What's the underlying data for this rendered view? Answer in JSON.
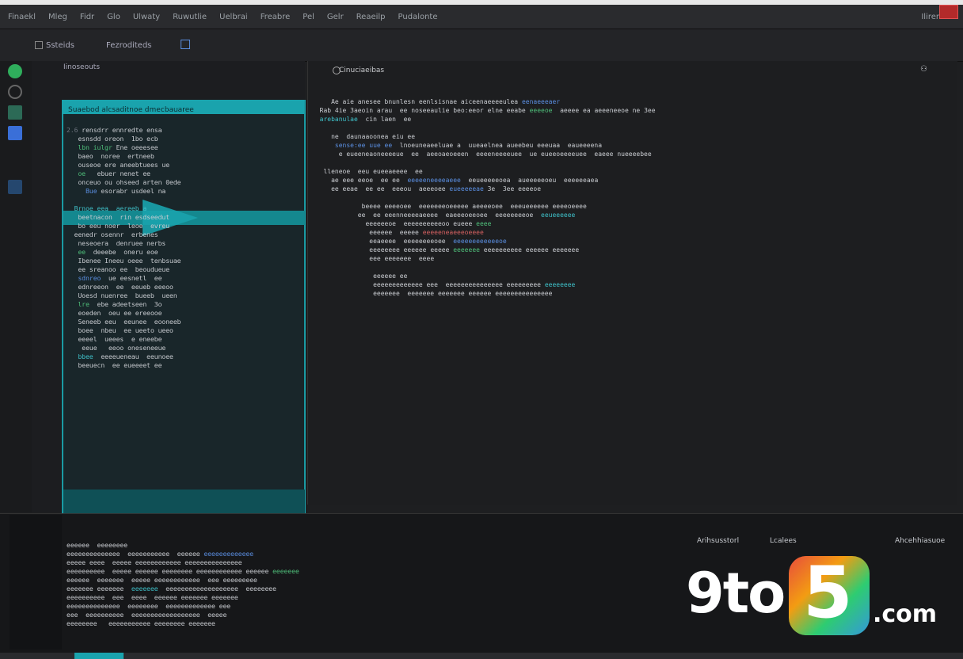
{
  "titlebar": {
    "menu": [
      "Finaekl",
      "Mleg",
      "Fidr",
      "Glo",
      "Ulwaty",
      "Ruwutlie",
      "Uelbrai",
      "Freabre",
      "Pel",
      "Gelr",
      "Reaeilp",
      "Pudalonte"
    ],
    "right_label": "Ilirer"
  },
  "toolbar": {
    "left_label": "Ssteids",
    "center_label": "Fezroditeds"
  },
  "explorer": {
    "header": "Iinoseouts",
    "teal_header": "Suaebod alcsaditnoe dmecbauaree"
  },
  "editor": {
    "tab_label": "Cinuciaeibas"
  },
  "bottom": {
    "right_labels": [
      "Arihsusstorl",
      "Lcalees",
      "Ahcehhiasuoe"
    ]
  },
  "logo": {
    "nine": "9to",
    "five": "5",
    "com": ".com"
  },
  "colors": {
    "accent": "#1aa3ad",
    "green": "#4fbf7a",
    "blue": "#5a8ee0",
    "red_close": "#b32a2a"
  }
}
